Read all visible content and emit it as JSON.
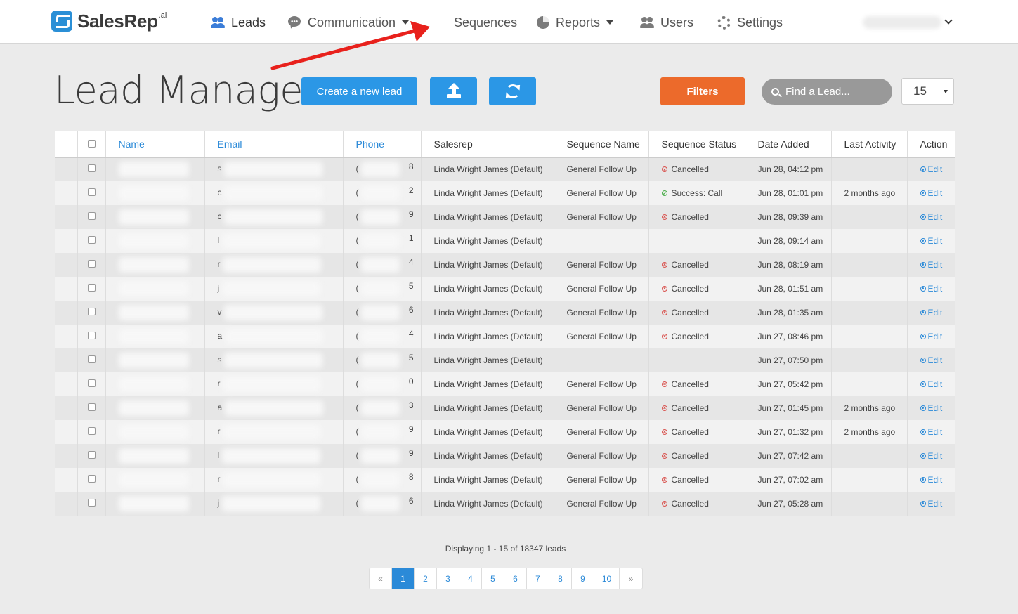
{
  "app": {
    "name": "SalesRep",
    "name_suffix": ".ai"
  },
  "nav": {
    "items": [
      {
        "label": "Leads",
        "icon": "users-icon",
        "active": true,
        "dropdown": false
      },
      {
        "label": "Communication",
        "icon": "chat-icon",
        "active": false,
        "dropdown": true
      },
      {
        "label": "Sequences",
        "icon": "layers-icon",
        "active": false,
        "dropdown": false
      },
      {
        "label": "Reports",
        "icon": "pie-chart-icon",
        "active": false,
        "dropdown": true
      },
      {
        "label": "Users",
        "icon": "users-icon",
        "active": false,
        "dropdown": false
      },
      {
        "label": "Settings",
        "icon": "gear-icon",
        "active": false,
        "dropdown": false
      }
    ]
  },
  "page": {
    "title": "Lead Manager",
    "create_label": "Create a new lead",
    "upload_icon": "upload-icon",
    "refresh_icon": "refresh-icon",
    "filters_label": "Filters",
    "search_placeholder": "Find a Lead...",
    "per_page": "15"
  },
  "colors": {
    "accent_blue": "#2b97e6",
    "filters_orange": "#ec6a2b",
    "annotation_red": "#e8211c"
  },
  "table": {
    "headers": {
      "name": "Name",
      "email": "Email",
      "phone": "Phone",
      "salesrep": "Salesrep",
      "sequence_name": "Sequence Name",
      "sequence_status": "Sequence Status",
      "date_added": "Date Added",
      "last_activity": "Last Activity",
      "action": "Action"
    },
    "rows": [
      {
        "email_start": "s",
        "phone_end": "8",
        "salesrep": "Linda Wright James (Default)",
        "sequence": "General Follow Up",
        "status": "Cancelled",
        "status_type": "cancel",
        "date": "Jun 28, 04:12 pm",
        "last_activity": "",
        "action": "Edit"
      },
      {
        "email_start": "c",
        "phone_end": "2",
        "salesrep": "Linda Wright James (Default)",
        "sequence": "General Follow Up",
        "status": "Success: Call",
        "status_type": "success",
        "date": "Jun 28, 01:01 pm",
        "last_activity": "2 months ago",
        "action": "Edit"
      },
      {
        "email_start": "c",
        "phone_end": "9",
        "salesrep": "Linda Wright James (Default)",
        "sequence": "General Follow Up",
        "status": "Cancelled",
        "status_type": "cancel",
        "date": "Jun 28, 09:39 am",
        "last_activity": "",
        "action": "Edit"
      },
      {
        "email_start": "l",
        "phone_end": "1",
        "salesrep": "Linda Wright James (Default)",
        "sequence": "",
        "status": "",
        "status_type": "",
        "date": "Jun 28, 09:14 am",
        "last_activity": "",
        "action": "Edit"
      },
      {
        "email_start": "r",
        "phone_end": "4",
        "salesrep": "Linda Wright James (Default)",
        "sequence": "General Follow Up",
        "status": "Cancelled",
        "status_type": "cancel",
        "date": "Jun 28, 08:19 am",
        "last_activity": "",
        "action": "Edit"
      },
      {
        "email_start": "j",
        "phone_end": "5",
        "salesrep": "Linda Wright James (Default)",
        "sequence": "General Follow Up",
        "status": "Cancelled",
        "status_type": "cancel",
        "date": "Jun 28, 01:51 am",
        "last_activity": "",
        "action": "Edit"
      },
      {
        "email_start": "v",
        "phone_end": "6",
        "salesrep": "Linda Wright James (Default)",
        "sequence": "General Follow Up",
        "status": "Cancelled",
        "status_type": "cancel",
        "date": "Jun 28, 01:35 am",
        "last_activity": "",
        "action": "Edit"
      },
      {
        "email_start": "a",
        "phone_end": "4",
        "salesrep": "Linda Wright James (Default)",
        "sequence": "General Follow Up",
        "status": "Cancelled",
        "status_type": "cancel",
        "date": "Jun 27, 08:46 pm",
        "last_activity": "",
        "action": "Edit"
      },
      {
        "email_start": "s",
        "phone_end": "5",
        "salesrep": "Linda Wright James (Default)",
        "sequence": "",
        "status": "",
        "status_type": "",
        "date": "Jun 27, 07:50 pm",
        "last_activity": "",
        "action": "Edit"
      },
      {
        "email_start": "r",
        "phone_end": "0",
        "salesrep": "Linda Wright James (Default)",
        "sequence": "General Follow Up",
        "status": "Cancelled",
        "status_type": "cancel",
        "date": "Jun 27, 05:42 pm",
        "last_activity": "",
        "action": "Edit"
      },
      {
        "email_start": "a",
        "phone_end": "3",
        "salesrep": "Linda Wright James (Default)",
        "sequence": "General Follow Up",
        "status": "Cancelled",
        "status_type": "cancel",
        "date": "Jun 27, 01:45 pm",
        "last_activity": "2 months ago",
        "action": "Edit"
      },
      {
        "email_start": "r",
        "phone_end": "9",
        "salesrep": "Linda Wright James (Default)",
        "sequence": "General Follow Up",
        "status": "Cancelled",
        "status_type": "cancel",
        "date": "Jun 27, 01:32 pm",
        "last_activity": "2 months ago",
        "action": "Edit"
      },
      {
        "email_start": "l",
        "phone_end": "9",
        "salesrep": "Linda Wright James (Default)",
        "sequence": "General Follow Up",
        "status": "Cancelled",
        "status_type": "cancel",
        "date": "Jun 27, 07:42 am",
        "last_activity": "",
        "action": "Edit"
      },
      {
        "email_start": "r",
        "phone_end": "8",
        "salesrep": "Linda Wright James (Default)",
        "sequence": "General Follow Up",
        "status": "Cancelled",
        "status_type": "cancel",
        "date": "Jun 27, 07:02 am",
        "last_activity": "",
        "action": "Edit"
      },
      {
        "email_start": "j",
        "phone_end": "6",
        "salesrep": "Linda Wright James (Default)",
        "sequence": "General Follow Up",
        "status": "Cancelled",
        "status_type": "cancel",
        "date": "Jun 27, 05:28 am",
        "last_activity": "",
        "action": "Edit"
      }
    ]
  },
  "pagination": {
    "summary_prefix": "Displaying ",
    "summary_range": "1 - 15",
    "summary_middle": " of ",
    "summary_total": "18347",
    "summary_suffix": " leads",
    "prev": "«",
    "next": "»",
    "pages": [
      "1",
      "2",
      "3",
      "4",
      "5",
      "6",
      "7",
      "8",
      "9",
      "10"
    ],
    "current": "1"
  }
}
